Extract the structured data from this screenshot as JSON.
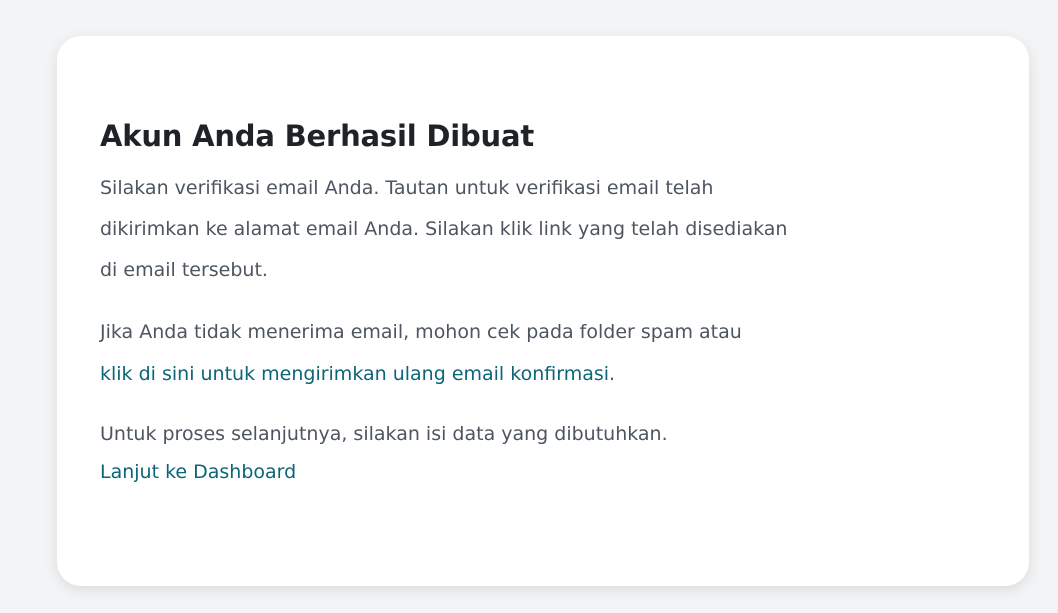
{
  "card": {
    "title": "Akun Anda Berhasil Dibuat",
    "verify_paragraph": {
      "line1": "Silakan verifikasi email Anda. Tautan untuk verifikasi email telah",
      "line2": "dikirimkan ke alamat email Anda. Silakan klik link yang telah disediakan",
      "line3": "di email tersebut."
    },
    "resend_paragraph": {
      "text": "Jika Anda tidak menerima email, mohon cek pada folder spam atau",
      "link": "klik di sini untuk mengirimkan ulang email konfirmasi",
      "suffix": "."
    },
    "next_paragraph": {
      "text": "Untuk proses selanjutnya, silakan isi data yang dibutuhkan.",
      "link": "Lanjut ke Dashboard"
    }
  },
  "colors": {
    "background": "#f3f4f6",
    "card": "#ffffff",
    "title": "#1f2328",
    "body_text": "#4d5560",
    "link": "#0c6577"
  }
}
